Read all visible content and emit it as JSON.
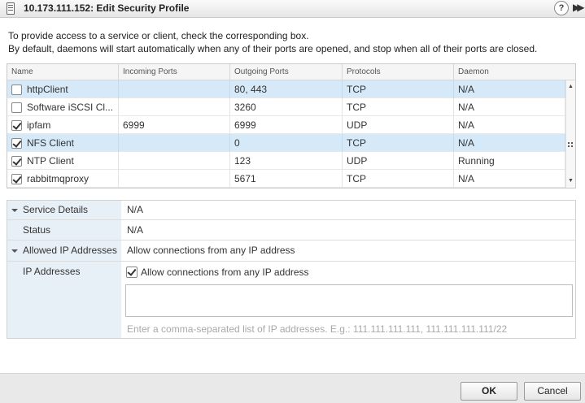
{
  "window": {
    "title": "10.173.111.152: Edit Security Profile",
    "help_label": "?",
    "expand_label": "▶▶"
  },
  "description": {
    "line1": "To provide access to a service or client, check the corresponding box.",
    "line2": "By default, daemons will start automatically when any of their ports are opened, and stop when all of their ports are closed."
  },
  "table": {
    "columns": [
      "Name",
      "Incoming Ports",
      "Outgoing Ports",
      "Protocols",
      "Daemon"
    ],
    "rows": [
      {
        "checked": false,
        "name": "httpClient",
        "incoming": "",
        "outgoing": "80, 443",
        "protocol": "TCP",
        "daemon": "N/A",
        "selected": true
      },
      {
        "checked": false,
        "name": "Software iSCSI Cl...",
        "incoming": "",
        "outgoing": "3260",
        "protocol": "TCP",
        "daemon": "N/A",
        "selected": false
      },
      {
        "checked": true,
        "name": "ipfam",
        "incoming": "6999",
        "outgoing": "6999",
        "protocol": "UDP",
        "daemon": "N/A",
        "selected": false
      },
      {
        "checked": true,
        "name": "NFS Client",
        "incoming": "",
        "outgoing": "0",
        "protocol": "TCP",
        "daemon": "N/A",
        "selected": true
      },
      {
        "checked": true,
        "name": "NTP Client",
        "incoming": "",
        "outgoing": "123",
        "protocol": "UDP",
        "daemon": "Running",
        "selected": false
      },
      {
        "checked": true,
        "name": "rabbitmqproxy",
        "incoming": "",
        "outgoing": "5671",
        "protocol": "TCP",
        "daemon": "N/A",
        "selected": false
      }
    ]
  },
  "details": {
    "service_details_label": "Service Details",
    "service_details_value": "N/A",
    "status_label": "Status",
    "status_value": "N/A",
    "allowed_ip_label": "Allowed IP Addresses",
    "allowed_ip_value": "Allow connections from any IP address",
    "ip_addresses_label": "IP Addresses",
    "allow_any_checked": true,
    "allow_any_label": "Allow connections from any IP address",
    "ip_list_value": "",
    "ip_hint": "Enter a comma-separated list of IP addresses. E.g.: 111.111.111.111, 111.111.111.111/22"
  },
  "footer": {
    "ok_label": "OK",
    "cancel_label": "Cancel"
  }
}
